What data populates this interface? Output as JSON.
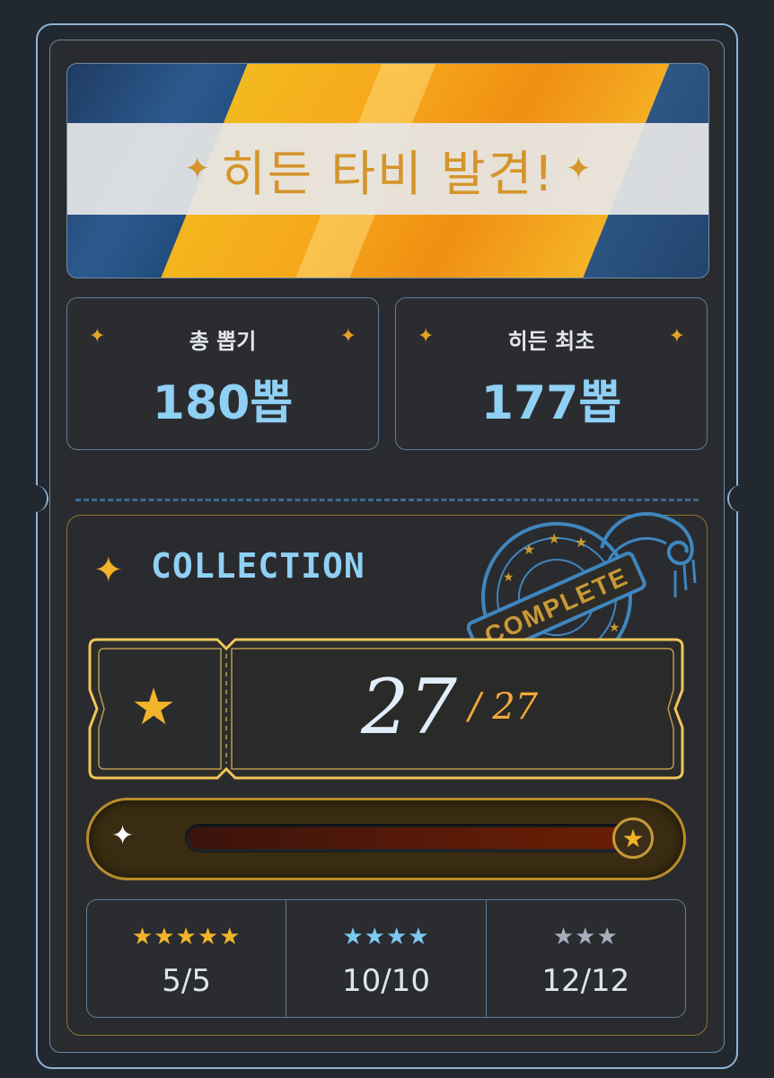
{
  "banner": {
    "title": "히든 타비 발견!",
    "spark": "✦"
  },
  "stats": [
    {
      "label": "총 뽑기",
      "value": "180뽑"
    },
    {
      "label": "히든 최초",
      "value": "177뽑"
    }
  ],
  "collection": {
    "title": "COLLECTION",
    "stamp_text": "COMPLETE",
    "collected": "27",
    "total": "/ 27",
    "progress": 1.0,
    "tiers": [
      {
        "stars": "★★★★★",
        "count": "5/5",
        "color": "#f2b42a"
      },
      {
        "stars": "★★★★",
        "count": "10/10",
        "color": "#7cc9f1"
      },
      {
        "stars": "★★★",
        "count": "12/12",
        "color": "#a7aebb"
      }
    ]
  },
  "colors": {
    "accent_blue": "#8fd0f4",
    "accent_gold": "#f2b42a",
    "stamp": "#3f86bf"
  }
}
